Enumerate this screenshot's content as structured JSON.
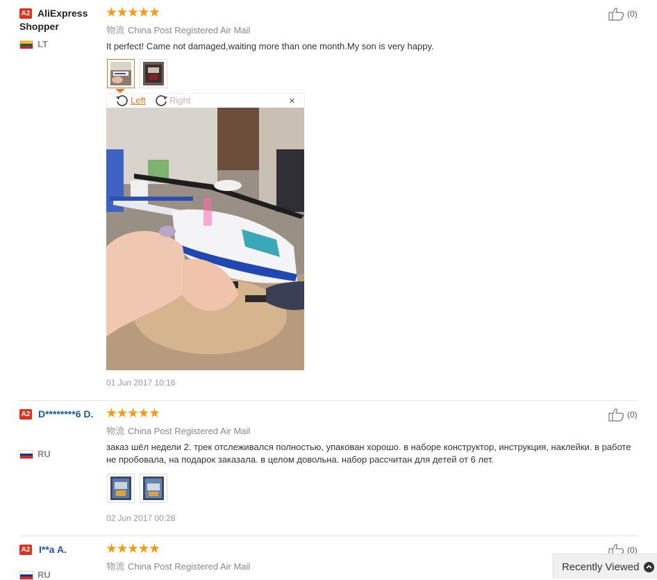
{
  "reviews": [
    {
      "badge": "A2",
      "user_name": "AliExpress Shopper",
      "country": "LT",
      "rating": 5,
      "shipping_label": "物流",
      "shipping": "China Post Registered Air Mail",
      "text": "It perfect! Came not damaged,waiting more than one month.My son is very happy.",
      "date": "01 Jun 2017 10:16",
      "helpful_count": "(0)",
      "viewer": {
        "rotate_left": "Left",
        "rotate_right": "Right",
        "close": "×"
      }
    },
    {
      "badge": "A2",
      "user_name": "D********6 D.",
      "country": "RU",
      "rating": 5,
      "shipping_label": "物流",
      "shipping": "China Post Registered Air Mail",
      "text": "заказ шёл недели 2. трек отслеживался полностью, упакован хорошо. в наборе конструктор, инструкция, наклейки. в работе не пробовала, на подарок заказала. в целом довольна. набор рассчитан для детей от 6 лет.",
      "date": "02 Jun 2017 00:28",
      "helpful_count": "(0)"
    },
    {
      "badge": "A2",
      "user_name": "I**a A.",
      "country": "RU",
      "rating": 5,
      "shipping_label": "物流",
      "shipping": "China Post Registered Air Mail",
      "helpful_count": "(0)"
    }
  ],
  "recently_viewed": "Recently Viewed",
  "colors": {
    "star": "#f59a13",
    "badge": "#e0311d",
    "accent": "#e8771a",
    "username_blue": "#1a56a8"
  }
}
